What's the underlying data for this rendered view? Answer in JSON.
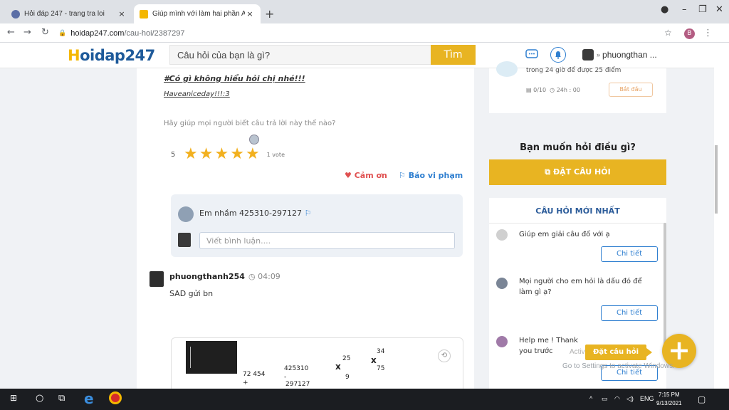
{
  "browser": {
    "tabs": [
      {
        "title": "Hỏi đáp 247 - trang tra loi",
        "active": false
      },
      {
        "title": "Giúp mình với làm hai phần A Vớ",
        "active": true
      }
    ],
    "new_tab": "+",
    "close": "×",
    "address_host": "hoidap247.com",
    "address_path": "/cau-hoi/2387297",
    "profile_initial": "B"
  },
  "site": {
    "logo_first": "H",
    "logo_rest": "oidap247",
    "search_placeholder": "Câu hỏi của bạn là gì?",
    "search_button": "Tìm",
    "username": "phuongthan ..."
  },
  "answer_prev": {
    "signature_line1": "#Có gì không hiểu hỏi chị nhé!!!",
    "signature_line2": "Haveaniceday!!!:3",
    "help_prompt": "Hãy giúp mọi người biết câu trả lời này thế nào?",
    "rating_value": "5",
    "rating_stars": 5,
    "votes": "1 vote",
    "thanks_label": "Cảm ơn",
    "report_label": "Báo vi phạm",
    "comment_text": "Em nhầm 425310-297127",
    "comment_placeholder": "Viết bình luận...."
  },
  "answer": {
    "author": "phuongthanh254",
    "time": "04:09",
    "text": "SAD gửi bn",
    "math": {
      "a": "72 454",
      "plus": "+",
      "b": "425310",
      "minus": "-",
      "c": "297127",
      "d": "25",
      "e": "9",
      "f": "34",
      "g": "75",
      "times": "x"
    }
  },
  "sidebar": {
    "challenge_text": "trong 24 giờ để được 25 điểm",
    "challenge_progress": "0/10",
    "challenge_time": "24h : 00",
    "challenge_button": "Bắt đầu",
    "ask_heading": "Bạn muốn hỏi điều gì?",
    "ask_button": "ĐẶT CÂU HỎI",
    "new_questions_heading": "CÂU HỎI MỚI NHẤT",
    "questions": [
      {
        "text": "Giúp em giải câu đố với ạ",
        "button": "Chi tiết"
      },
      {
        "text": "Mọi người cho em hỏi là dấu đó để làm gì ạ?",
        "button": "Chi tiết"
      },
      {
        "text": "Help me ! Thank you trước",
        "button": "Chi tiết"
      }
    ]
  },
  "floating": {
    "label": "Đặt câu hỏi",
    "plus": "+",
    "activate_line1": "Activate Windows",
    "activate_line2": "Go to Settings to activate Windows."
  },
  "taskbar": {
    "lang": "ENG",
    "time": "7:15 PM",
    "date": "9/13/2021"
  },
  "colors": {
    "accent": "#e8b422",
    "link_blue": "#2f7fd0",
    "heart_red": "#e05050",
    "logo_blue": "#1e5a9a"
  }
}
